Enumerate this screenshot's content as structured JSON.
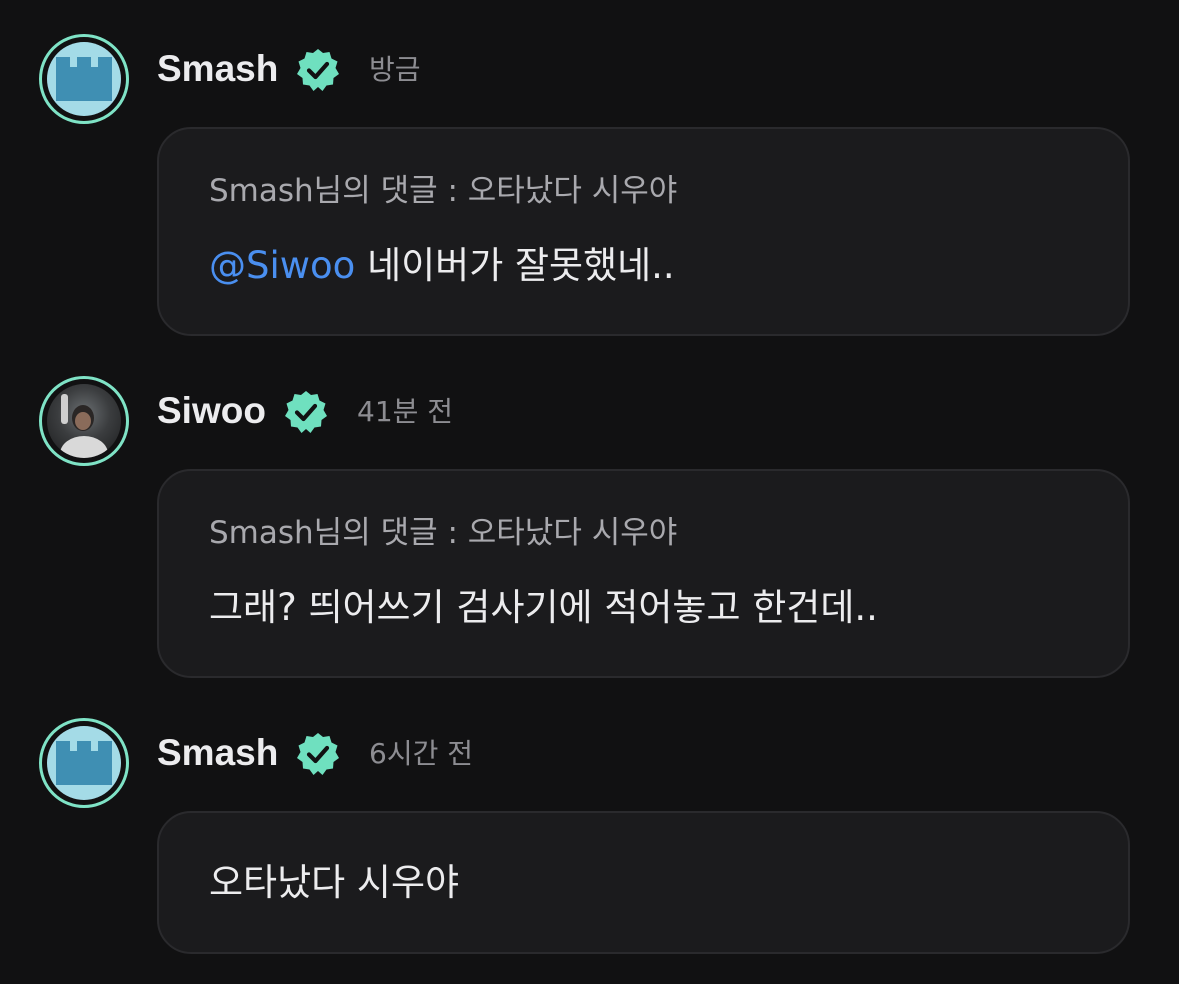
{
  "comments": [
    {
      "author": "Smash",
      "avatar": "castle-icon",
      "verified": true,
      "time": "방금",
      "reply_ref": "Smash님의 댓글 : 오타났다 시우야",
      "mention": "@Siwoo",
      "text": "네이버가 잘못했네.."
    },
    {
      "author": "Siwoo",
      "avatar": "profile-photo",
      "verified": true,
      "time": "41분 전",
      "reply_ref": "Smash님의 댓글 : 오타났다 시우야",
      "text": "그래? 띄어쓰기 검사기에 적어놓고 한건데.."
    },
    {
      "author": "Smash",
      "avatar": "castle-icon",
      "verified": true,
      "time": "6시간 전",
      "text": "오타났다 시우야"
    }
  ],
  "colors": {
    "background": "#111112",
    "bubble": "#1b1b1d",
    "verified_badge": "#6fe0bf",
    "avatar_ring": "#7fe3c6",
    "mention": "#4a8ff0"
  }
}
